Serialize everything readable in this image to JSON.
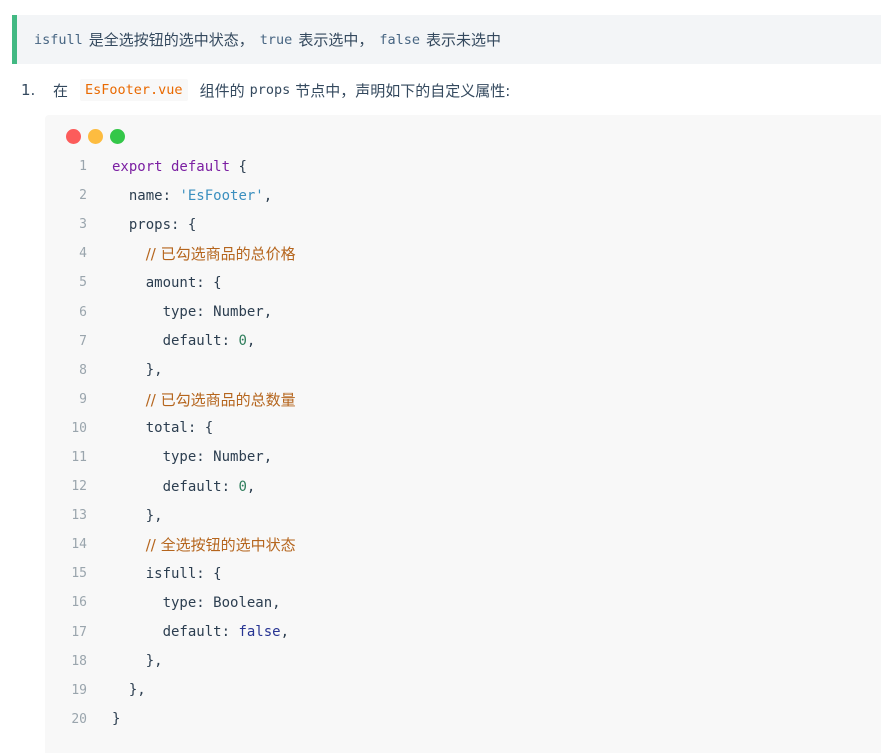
{
  "tip": {
    "code1": "isfull",
    "text1": "是全选按钮的选中状态，",
    "code2": "true",
    "text2": "表示选中，",
    "code3": "false",
    "text3": "表示未选中"
  },
  "list_item": {
    "number": "1.",
    "prefix": "在",
    "file": "EsFooter.vue",
    "mid": "组件的",
    "code": "props",
    "suffix": "节点中，声明如下的自定义属性:"
  },
  "code_block": {
    "dot_colors": [
      "#fc5c5b",
      "#fdbc40",
      "#34c749"
    ],
    "token_colors": {
      "keyword": "#7b1fa2",
      "string": "#3a8fbf",
      "comment": "#b5651d",
      "number": "#2e7d5b",
      "bool": "#283593"
    },
    "lines": [
      {
        "no": "1",
        "indent": "",
        "tokens": [
          {
            "t": "export default",
            "k": "keyword"
          },
          {
            "t": " {",
            "k": "punct"
          }
        ]
      },
      {
        "no": "2",
        "indent": "  ",
        "tokens": [
          {
            "t": "name",
            "k": "plain"
          },
          {
            "t": ": ",
            "k": "punct"
          },
          {
            "t": "'EsFooter'",
            "k": "string"
          },
          {
            "t": ",",
            "k": "punct"
          }
        ]
      },
      {
        "no": "3",
        "indent": "  ",
        "tokens": [
          {
            "t": "props",
            "k": "plain"
          },
          {
            "t": ": {",
            "k": "punct"
          }
        ]
      },
      {
        "no": "4",
        "indent": "    ",
        "tokens": [
          {
            "t": "// 已勾选商品的总价格",
            "k": "comment"
          }
        ]
      },
      {
        "no": "5",
        "indent": "    ",
        "tokens": [
          {
            "t": "amount",
            "k": "plain"
          },
          {
            "t": ": {",
            "k": "punct"
          }
        ]
      },
      {
        "no": "6",
        "indent": "      ",
        "tokens": [
          {
            "t": "type",
            "k": "plain"
          },
          {
            "t": ": ",
            "k": "punct"
          },
          {
            "t": "Number",
            "k": "class"
          },
          {
            "t": ",",
            "k": "punct"
          }
        ]
      },
      {
        "no": "7",
        "indent": "      ",
        "tokens": [
          {
            "t": "default",
            "k": "plain"
          },
          {
            "t": ": ",
            "k": "punct"
          },
          {
            "t": "0",
            "k": "number"
          },
          {
            "t": ",",
            "k": "punct"
          }
        ]
      },
      {
        "no": "8",
        "indent": "    ",
        "tokens": [
          {
            "t": "},",
            "k": "punct"
          }
        ]
      },
      {
        "no": "9",
        "indent": "    ",
        "tokens": [
          {
            "t": "// 已勾选商品的总数量",
            "k": "comment"
          }
        ]
      },
      {
        "no": "10",
        "indent": "    ",
        "tokens": [
          {
            "t": "total",
            "k": "plain"
          },
          {
            "t": ": {",
            "k": "punct"
          }
        ]
      },
      {
        "no": "11",
        "indent": "      ",
        "tokens": [
          {
            "t": "type",
            "k": "plain"
          },
          {
            "t": ": ",
            "k": "punct"
          },
          {
            "t": "Number",
            "k": "class"
          },
          {
            "t": ",",
            "k": "punct"
          }
        ]
      },
      {
        "no": "12",
        "indent": "      ",
        "tokens": [
          {
            "t": "default",
            "k": "plain"
          },
          {
            "t": ": ",
            "k": "punct"
          },
          {
            "t": "0",
            "k": "number"
          },
          {
            "t": ",",
            "k": "punct"
          }
        ]
      },
      {
        "no": "13",
        "indent": "    ",
        "tokens": [
          {
            "t": "},",
            "k": "punct"
          }
        ]
      },
      {
        "no": "14",
        "indent": "    ",
        "tokens": [
          {
            "t": "// 全选按钮的选中状态",
            "k": "comment"
          }
        ]
      },
      {
        "no": "15",
        "indent": "    ",
        "tokens": [
          {
            "t": "isfull",
            "k": "plain"
          },
          {
            "t": ": {",
            "k": "punct"
          }
        ]
      },
      {
        "no": "16",
        "indent": "      ",
        "tokens": [
          {
            "t": "type",
            "k": "plain"
          },
          {
            "t": ": ",
            "k": "punct"
          },
          {
            "t": "Boolean",
            "k": "class"
          },
          {
            "t": ",",
            "k": "punct"
          }
        ]
      },
      {
        "no": "17",
        "indent": "      ",
        "tokens": [
          {
            "t": "default",
            "k": "plain"
          },
          {
            "t": ": ",
            "k": "punct"
          },
          {
            "t": "false",
            "k": "bool"
          },
          {
            "t": ",",
            "k": "punct"
          }
        ]
      },
      {
        "no": "18",
        "indent": "    ",
        "tokens": [
          {
            "t": "},",
            "k": "punct"
          }
        ]
      },
      {
        "no": "19",
        "indent": "  ",
        "tokens": [
          {
            "t": "},",
            "k": "punct"
          }
        ]
      },
      {
        "no": "20",
        "indent": "",
        "tokens": [
          {
            "t": "}",
            "k": "punct"
          }
        ]
      }
    ]
  }
}
